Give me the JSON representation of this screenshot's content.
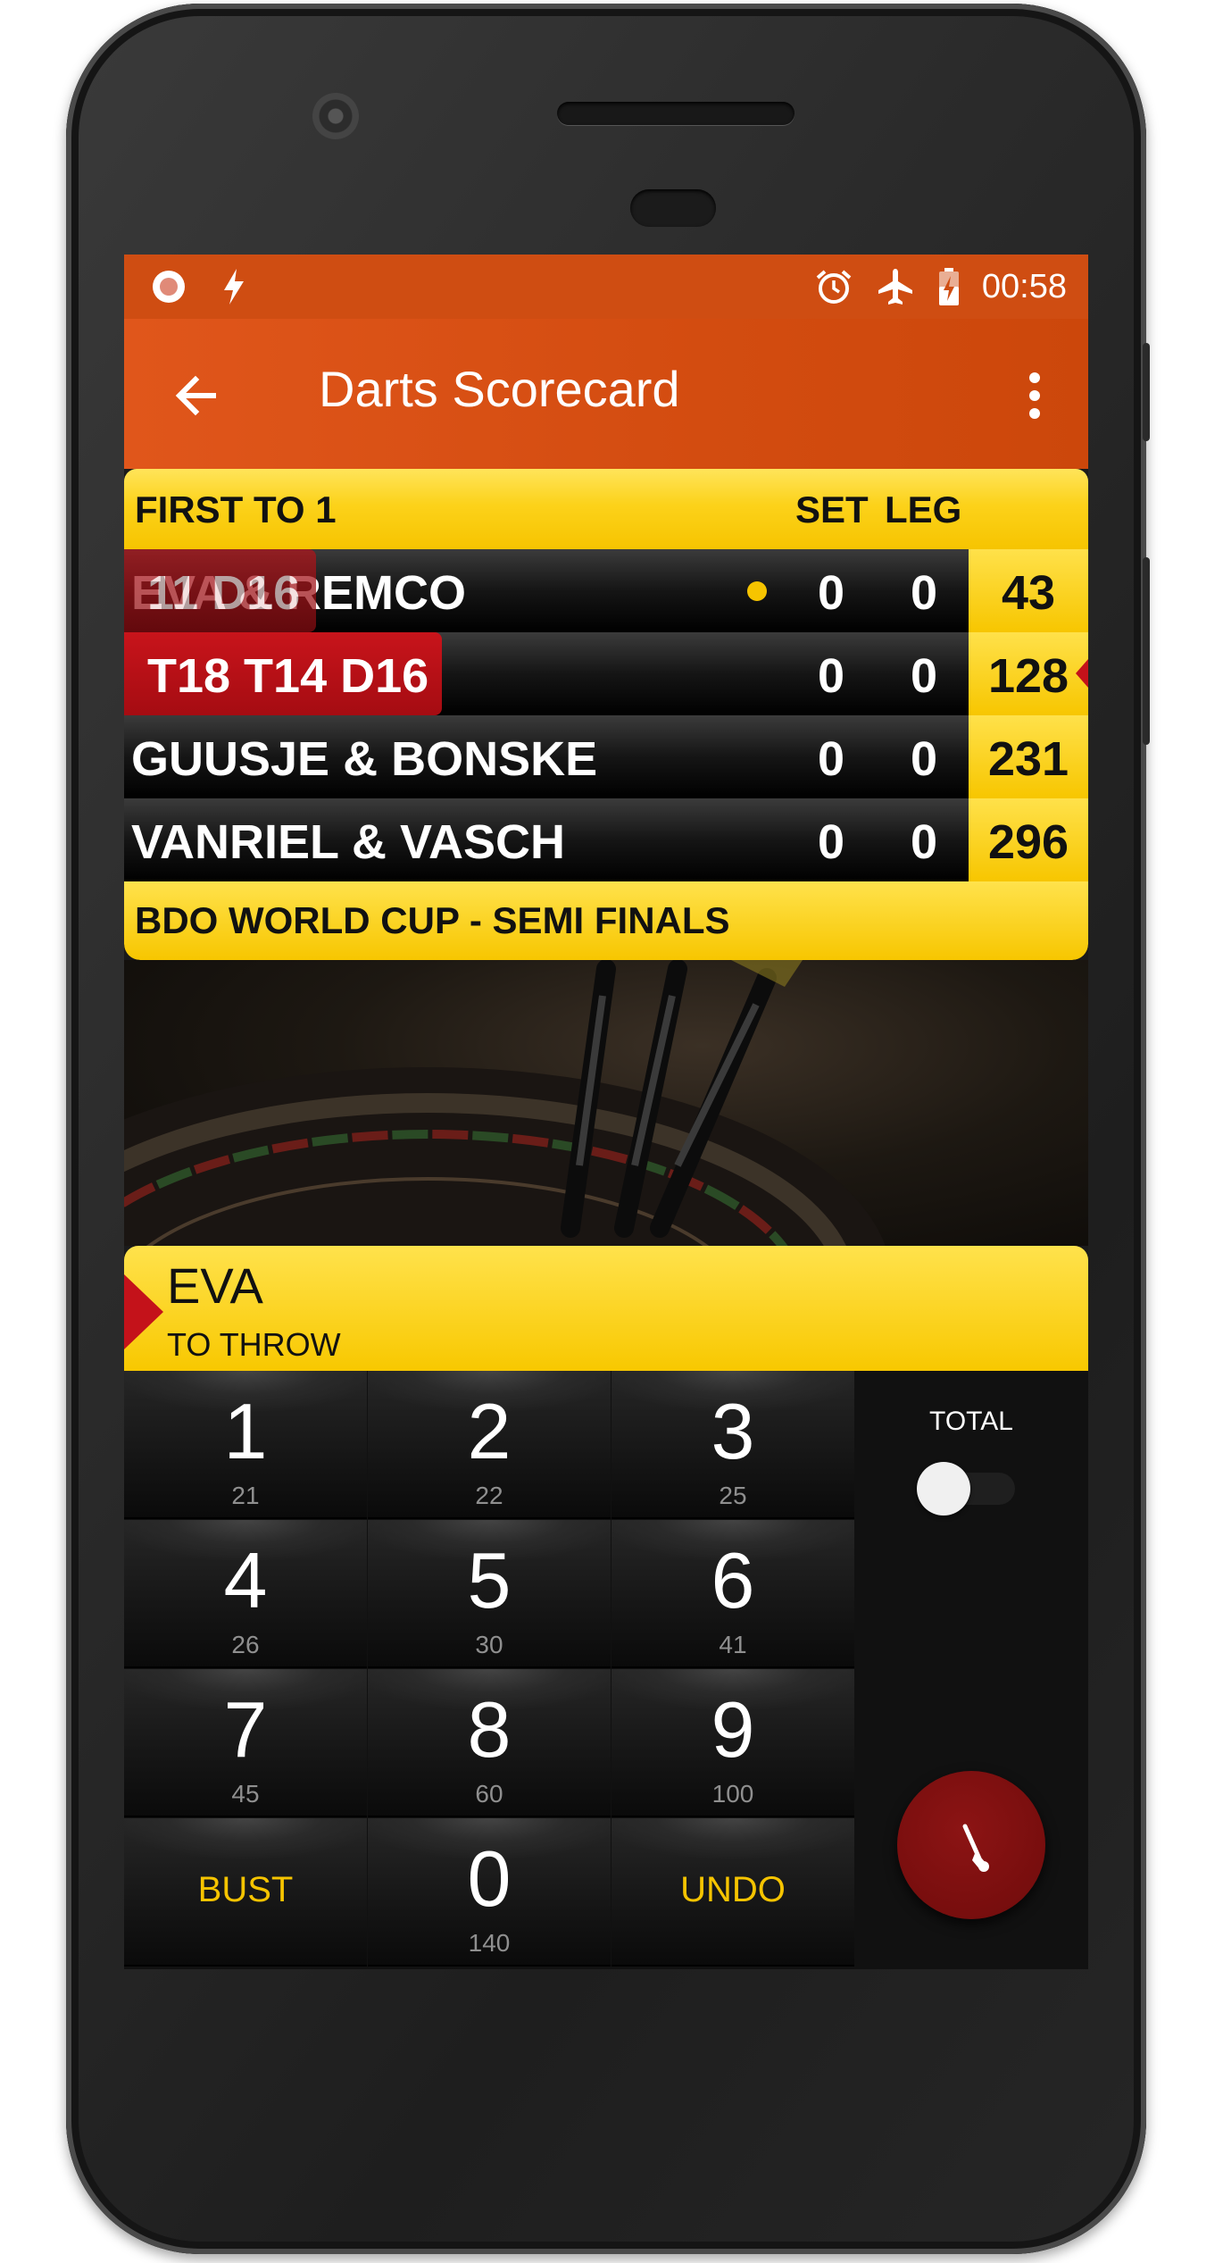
{
  "status_bar": {
    "time": "00:58",
    "icons": [
      "record-icon",
      "flash-icon",
      "alarm-icon",
      "airplane-icon",
      "battery-charging-icon"
    ]
  },
  "app_bar": {
    "title": "Darts Scorecard",
    "back_icon": "arrow-back-icon",
    "menu_icon": "more-vert-icon"
  },
  "scoreboard": {
    "header": {
      "format": "FIRST TO 1",
      "set_label": "SET",
      "leg_label": "LEG"
    },
    "rows": [
      {
        "name": "EVA & REMCO",
        "set": "0",
        "leg": "0",
        "score": "43",
        "checkout": "11 D16",
        "starter": true
      },
      {
        "name": "",
        "set": "0",
        "leg": "0",
        "score": "128",
        "checkout": "T18 T14 D16",
        "active": true
      },
      {
        "name": "GUUSJE & BONSKE",
        "set": "0",
        "leg": "0",
        "score": "231"
      },
      {
        "name": "VANRIEL & VASCH",
        "set": "0",
        "leg": "0",
        "score": "296"
      }
    ],
    "footer": "BDO WORLD CUP - SEMI FINALS"
  },
  "thrower": {
    "name": "EVA",
    "subtitle": "TO THROW"
  },
  "keypad": {
    "keys": [
      {
        "main": "1",
        "sub": "21"
      },
      {
        "main": "2",
        "sub": "22"
      },
      {
        "main": "3",
        "sub": "25"
      },
      {
        "main": "4",
        "sub": "26"
      },
      {
        "main": "5",
        "sub": "30"
      },
      {
        "main": "6",
        "sub": "41"
      },
      {
        "main": "7",
        "sub": "45"
      },
      {
        "main": "8",
        "sub": "60"
      },
      {
        "main": "9",
        "sub": "100"
      },
      {
        "main": "0",
        "sub": "140"
      }
    ],
    "bust_label": "BUST",
    "undo_label": "UNDO"
  },
  "total_panel": {
    "label": "TOTAL",
    "toggle_on": false
  },
  "colors": {
    "accent": "#d34c10",
    "yellow": "#f6c400",
    "red": "#c4121a"
  }
}
